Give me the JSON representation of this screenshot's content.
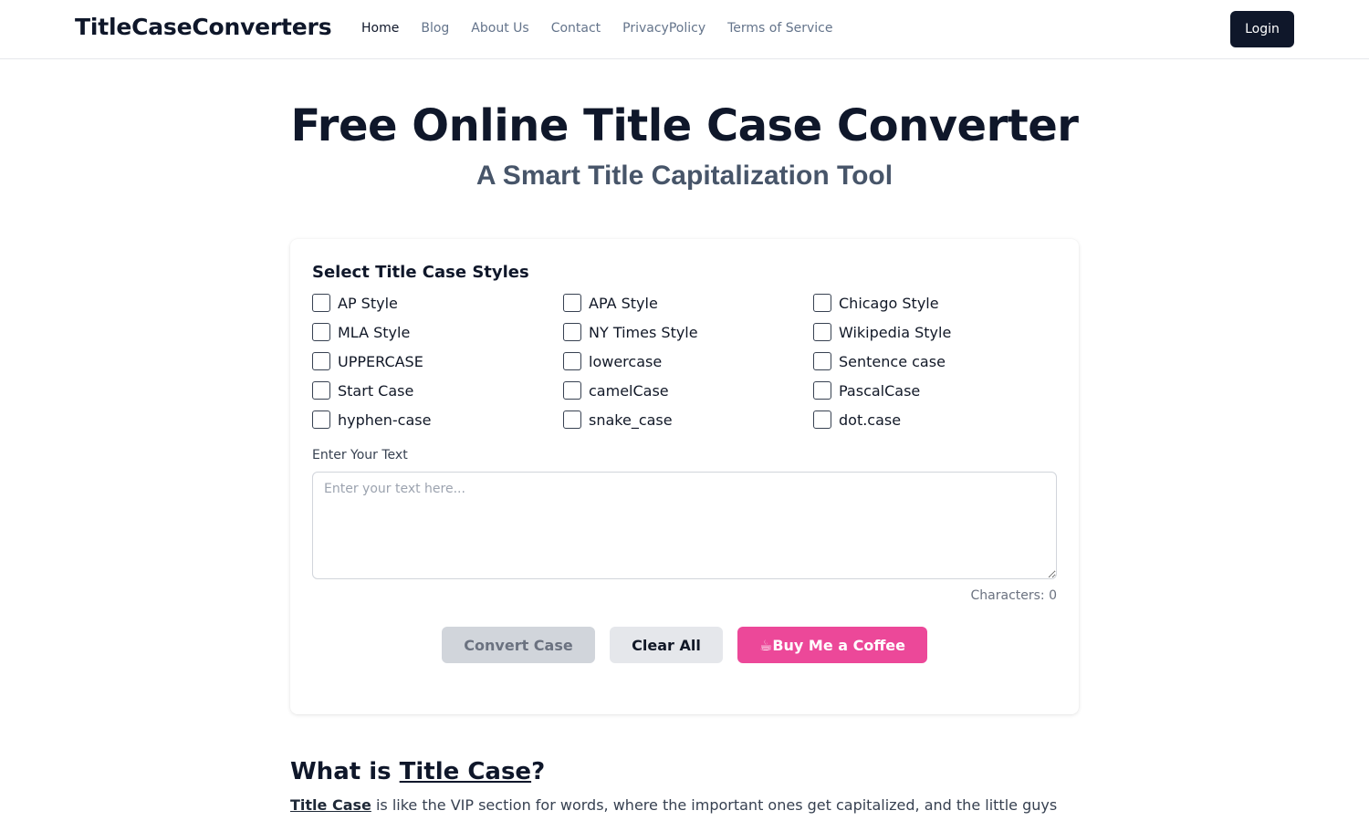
{
  "header": {
    "brand": "TitleCaseConverters",
    "nav": [
      {
        "label": "Home",
        "active": true
      },
      {
        "label": "Blog",
        "active": false
      },
      {
        "label": "About Us",
        "active": false
      },
      {
        "label": "Contact",
        "active": false
      },
      {
        "label": "PrivacyPolicy",
        "active": false
      },
      {
        "label": "Terms of Service",
        "active": false
      }
    ],
    "login_label": "Login"
  },
  "hero": {
    "title": "Free Online Title Case Converter",
    "subtitle": "A Smart Title Capitalization Tool"
  },
  "converter": {
    "styles_heading": "Select Title Case Styles",
    "options": [
      {
        "label": "AP Style",
        "checked": false
      },
      {
        "label": "APA Style",
        "checked": false
      },
      {
        "label": "Chicago Style",
        "checked": false
      },
      {
        "label": "MLA Style",
        "checked": false
      },
      {
        "label": "NY Times Style",
        "checked": false
      },
      {
        "label": "Wikipedia Style",
        "checked": false
      },
      {
        "label": "UPPERCASE",
        "checked": false
      },
      {
        "label": "lowercase",
        "checked": false
      },
      {
        "label": "Sentence case",
        "checked": false
      },
      {
        "label": "Start Case",
        "checked": false
      },
      {
        "label": "camelCase",
        "checked": false
      },
      {
        "label": "PascalCase",
        "checked": false
      },
      {
        "label": "hyphen-case",
        "checked": false
      },
      {
        "label": "snake_case",
        "checked": false
      },
      {
        "label": "dot.case",
        "checked": false
      }
    ],
    "text_label": "Enter Your Text",
    "text_value": "",
    "text_placeholder": "Enter your text here...",
    "char_count_text": "Characters: 0",
    "convert_label": "Convert Case",
    "clear_label": "Clear All",
    "coffee_icon": "coffee-cup-icon",
    "coffee_label": "☕Buy Me a Coffee"
  },
  "article": {
    "heading_prefix": "What is ",
    "heading_link": "Title Case",
    "heading_suffix": "?",
    "p1_link": "Title Case",
    "p1_text": " is like the VIP section for words, where the important ones get capitalized, and the little guys"
  },
  "colors": {
    "primary_dark": "#0f172a",
    "coffee_pink": "#ec4899",
    "disabled_gray": "#d1d5db",
    "muted_text": "#64748b"
  }
}
